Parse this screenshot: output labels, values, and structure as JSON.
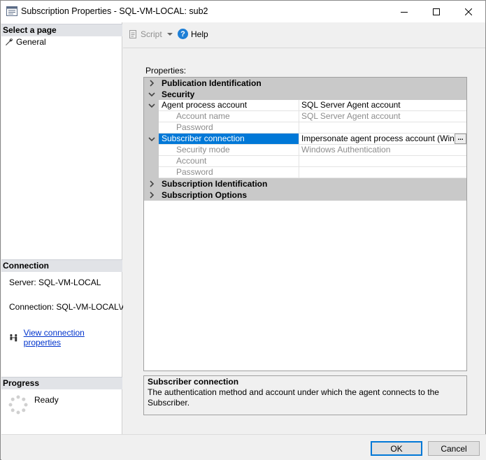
{
  "window": {
    "title": "Subscription Properties - SQL-VM-LOCAL: sub2"
  },
  "left": {
    "select_page_header": "Select a page",
    "pages": [
      {
        "label": "General",
        "icon": "wrench-icon"
      }
    ],
    "connection_header": "Connection",
    "server_text": "Server: SQL-VM-LOCAL",
    "connection_text": "Connection: SQL-VM-LOCAL\\Adm",
    "view_connection_link": "View connection properties",
    "progress_header": "Progress",
    "progress_status": "Ready"
  },
  "toolbar": {
    "script_label": "Script",
    "help_label": "Help"
  },
  "properties_label": "Properties:",
  "grid": {
    "categories": {
      "publication_identification": "Publication Identification",
      "security": "Security",
      "subscription_identification": "Subscription Identification",
      "subscription_options": "Subscription Options"
    },
    "rows": {
      "agent_process_account": {
        "name": "Agent process account",
        "value": "SQL Server Agent account"
      },
      "account_name": {
        "name": "Account name",
        "value": "SQL Server Agent account"
      },
      "password": {
        "name": "Password",
        "value": ""
      },
      "subscriber_connection": {
        "name": "Subscriber connection",
        "value": "Impersonate agent process account (Windows"
      },
      "security_mode": {
        "name": "Security mode",
        "value": "Windows Authentication"
      },
      "account": {
        "name": "Account",
        "value": ""
      },
      "password2": {
        "name": "Password",
        "value": ""
      }
    },
    "ellipsis": "..."
  },
  "description": {
    "title": "Subscriber connection",
    "text": "The authentication method and account under which the agent connects to the Subscriber."
  },
  "buttons": {
    "ok": "OK",
    "cancel": "Cancel"
  },
  "colors": {
    "selection": "#0078d7",
    "category_bg": "#c9c9c9",
    "link": "#0033cc"
  }
}
